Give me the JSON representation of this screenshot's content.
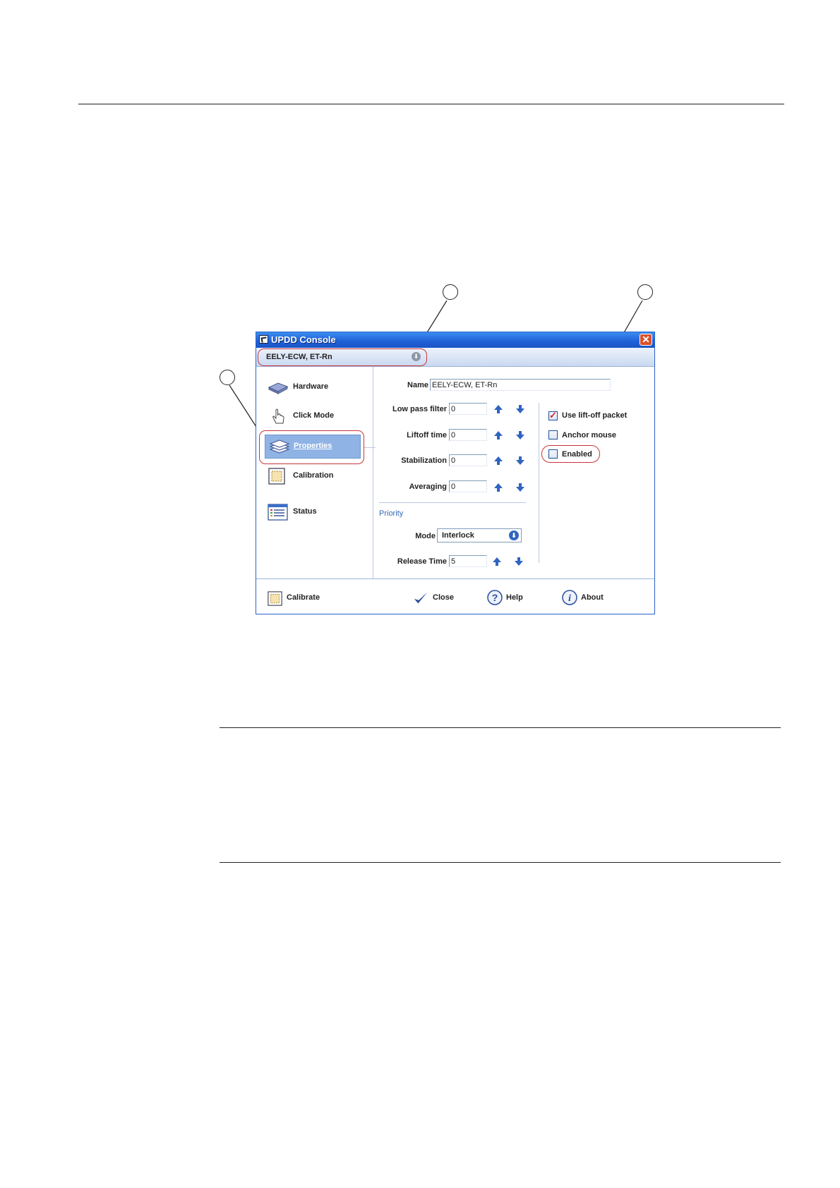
{
  "window": {
    "title": "UPDD Console",
    "close_glyph": "✕",
    "device": "EELY-ECW, ET-Rn",
    "device_dropdown_glyph": "⬇"
  },
  "sidebar": {
    "items": [
      {
        "label": "Hardware",
        "icon": "hardware-icon"
      },
      {
        "label": "Click Mode",
        "icon": "hand-pointer-icon"
      },
      {
        "label": "Properties",
        "icon": "layers-icon",
        "active": true
      },
      {
        "label": "Calibration",
        "icon": "calibration-icon"
      },
      {
        "label": "Status",
        "icon": "status-list-icon"
      }
    ]
  },
  "properties": {
    "name_label": "Name",
    "name_value": "EELY-ECW, ET-Rn",
    "low_pass_label": "Low pass filter",
    "low_pass_value": "0",
    "liftoff_label": "Liftoff time",
    "liftoff_value": "0",
    "stabilization_label": "Stabilization",
    "stabilization_value": "0",
    "averaging_label": "Averaging",
    "averaging_value": "0",
    "priority_heading": "Priority",
    "mode_label": "Mode",
    "mode_value": "Interlock",
    "release_label": "Release Time",
    "release_value": "5"
  },
  "options": {
    "use_liftoff_label": "Use lift-off packet",
    "use_liftoff_checked": true,
    "anchor_mouse_label": "Anchor mouse",
    "anchor_mouse_checked": false,
    "enabled_label": "Enabled",
    "enabled_checked": false
  },
  "footer": {
    "calibrate": "Calibrate",
    "close": "Close",
    "help": "Help",
    "about": "About"
  },
  "colors": {
    "highlight": "#c8353a",
    "accent": "#2f64c0"
  }
}
